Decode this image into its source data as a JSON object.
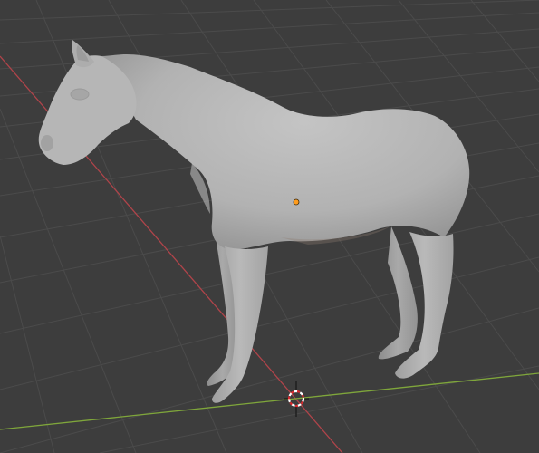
{
  "viewport": {
    "background_color": "#3d3d3d",
    "grid_color": "#4a4a4a",
    "x_axis_color": "#b0444a",
    "y_axis_color": "#7fa63b"
  },
  "scene": {
    "object": "horse-mesh",
    "object_color": "#b3b3b3",
    "origin_point_color": "#ff9c1c",
    "cursor_colors": [
      "#ffffff",
      "#d8292d"
    ],
    "icons": [
      "3d-cursor-icon",
      "object-origin-icon"
    ]
  }
}
